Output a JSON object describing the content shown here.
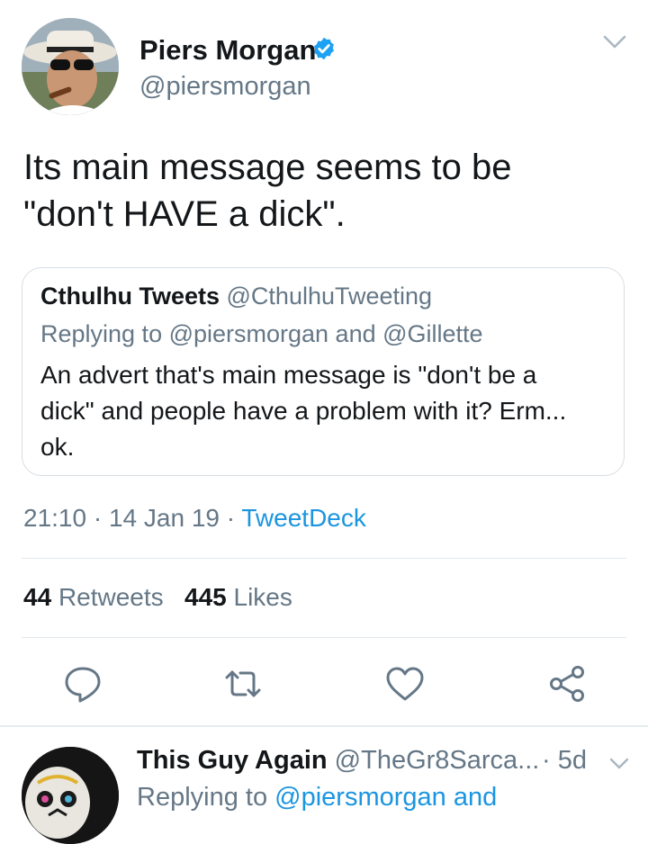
{
  "tweet": {
    "author_name": "Piers Morgan",
    "author_handle": "@piersmorgan",
    "verified": true,
    "text_line1": "Its main message seems to be",
    "text_line2": "\"don't HAVE a dick\".",
    "quoted": {
      "name": "Cthulhu Tweets",
      "handle": "@CthulhuTweeting",
      "replying_label": "Replying to @piersmorgan and @Gillette",
      "text_line1": "An advert that's main message is \"don't be a",
      "text_line2": "dick\" and people have a problem with it? Erm...",
      "text_line3": "ok."
    },
    "time": "21:10",
    "date": "14 Jan 19",
    "sep": " · ",
    "source": "TweetDeck",
    "retweets_count": "44",
    "retweets_label": "Retweets",
    "likes_count": "445",
    "likes_label": "Likes"
  },
  "actions": [
    "reply-icon",
    "retweet-icon",
    "like-icon",
    "share-icon"
  ],
  "reply": {
    "name": "This Guy Again",
    "handle": "@TheGr8Sarca...",
    "time": "· 5d",
    "replying_prefix": "Replying to",
    "replying_mention": "@piersmorgan and"
  },
  "colors": {
    "verified_blue": "#1da1f2",
    "link_blue": "#1b95e0",
    "secondary_gray": "#657786",
    "icon_gray": "#657786"
  }
}
